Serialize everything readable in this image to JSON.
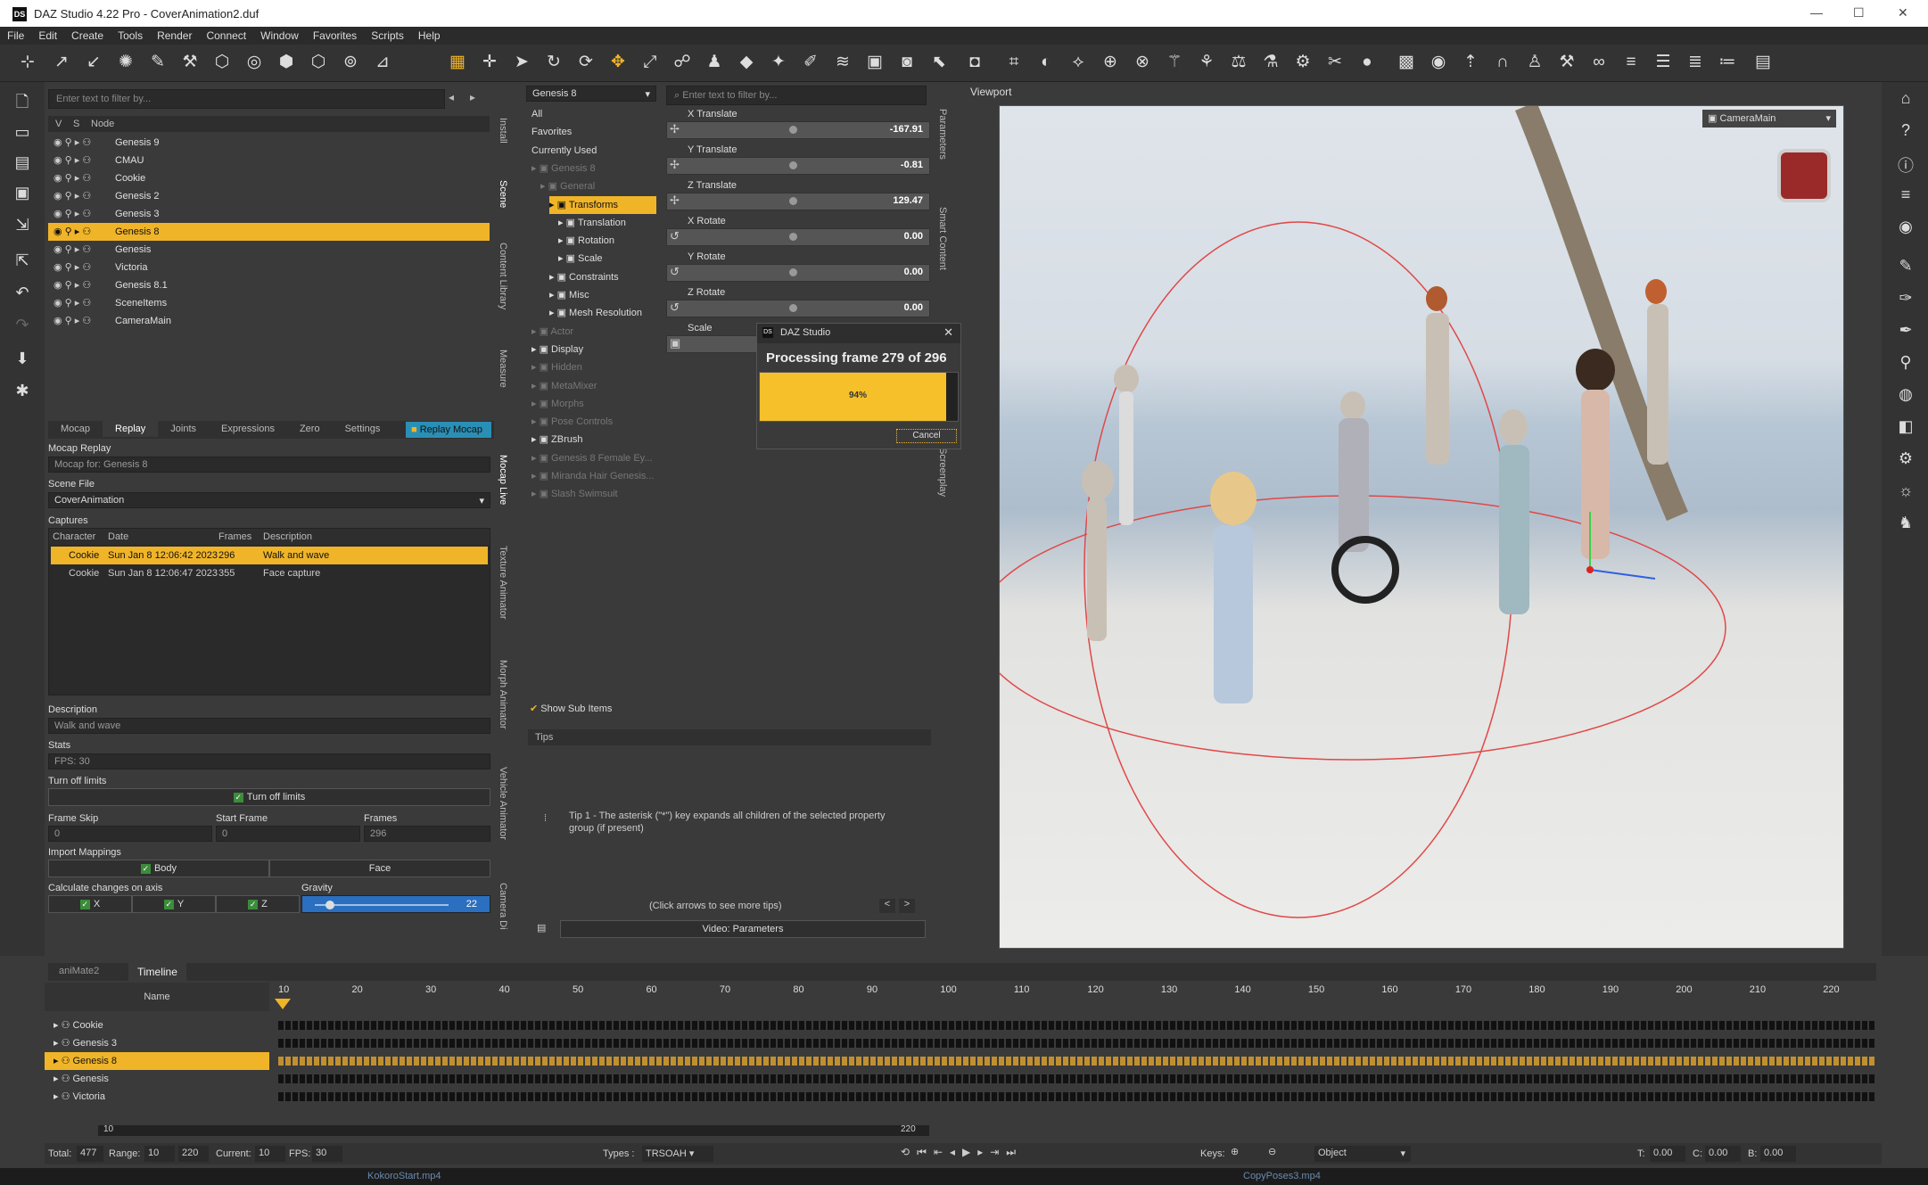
{
  "app": {
    "title": "DAZ Studio 4.22 Pro - CoverAnimation2.duf",
    "logo": "DS"
  },
  "menu": [
    "File",
    "Edit",
    "Create",
    "Tools",
    "Render",
    "Connect",
    "Window",
    "Favorites",
    "Scripts",
    "Help"
  ],
  "scene": {
    "filter_placeholder": "Enter text to filter by...",
    "col_v": "V",
    "col_s": "S",
    "col_node": "Node",
    "nodes": [
      "Genesis 9",
      "CMAU",
      "Cookie",
      "Genesis 2",
      "Genesis 3",
      "Genesis 8",
      "Genesis",
      "Victoria",
      "Genesis 8.1",
      "SceneItems",
      "CameraMain"
    ],
    "selected": "Genesis 8"
  },
  "side_tabs": {
    "install": "Install",
    "scene": "Scene",
    "content_library": "Content Library",
    "measure": "Measure",
    "mocap_live": "Mocap Live",
    "texture_animator": "Texture Animator",
    "morph_animator": "Morph Animator",
    "vehicle_animator": "Vehicle Animator",
    "camera_director": "Camera Di",
    "parameters": "Parameters",
    "smart_content": "Smart Content",
    "screenplay": "Screenplay"
  },
  "mocap": {
    "tabs": [
      "Mocap",
      "Replay",
      "Joints",
      "Expressions",
      "Zero",
      "Settings"
    ],
    "replay_button": "Replay Mocap",
    "section_title": "Mocap Replay",
    "mocap_for": "Mocap for: Genesis 8",
    "scene_file_label": "Scene File",
    "scene_file_value": "CoverAnimation",
    "captures_label": "Captures",
    "cap_headers": [
      "Character",
      "Date",
      "Frames",
      "Description"
    ],
    "captures": [
      {
        "character": "Cookie",
        "date": "Sun Jan 8 12:06:42 2023",
        "frames": "296",
        "description": "Walk and wave"
      },
      {
        "character": "Cookie",
        "date": "Sun Jan 8 12:06:47 2023",
        "frames": "355",
        "description": "Face capture"
      }
    ],
    "description_label": "Description",
    "description_value": "Walk and wave",
    "stats_label": "Stats",
    "stats_value": "FPS: 30",
    "turn_off_limits_label": "Turn off limits",
    "turn_off_limits_check": "Turn off limits",
    "frame_skip_label": "Frame Skip",
    "frame_skip_value": "0",
    "start_frame_label": "Start Frame",
    "start_frame_value": "0",
    "frames_label": "Frames",
    "frames_value": "296",
    "import_mappings_label": "Import Mappings",
    "body": "Body",
    "face": "Face",
    "calc_axis_label": "Calculate changes on axis",
    "axis_x": "X",
    "axis_y": "Y",
    "axis_z": "Z",
    "gravity_label": "Gravity",
    "gravity_value": "22"
  },
  "tree": {
    "selector": "Genesis 8",
    "items": [
      "All",
      "Favorites",
      "Currently Used",
      "Genesis 8",
      "General",
      "Transforms",
      "Translation",
      "Rotation",
      "Scale",
      "Constraints",
      "Misc",
      "Mesh Resolution",
      "Actor",
      "Display",
      "Hidden",
      "MetaMixer",
      "Morphs",
      "Pose Controls",
      "ZBrush",
      "Genesis 8 Female Ey...",
      "Miranda Hair Genesis...",
      "Slash Swimsuit"
    ],
    "show_sub": "Show Sub Items"
  },
  "params": {
    "filter_placeholder": "Enter text to filter by...",
    "rows": [
      {
        "name": "X Translate",
        "value": "-167.91"
      },
      {
        "name": "Y Translate",
        "value": "-0.81"
      },
      {
        "name": "Z Translate",
        "value": "129.47"
      },
      {
        "name": "X Rotate",
        "value": "0.00"
      },
      {
        "name": "Y Rotate",
        "value": "0.00"
      },
      {
        "name": "Z Rotate",
        "value": "0.00"
      },
      {
        "name": "Scale",
        "value": ""
      }
    ]
  },
  "tips": {
    "tab": "Tips",
    "text": "Tip 1 - The asterisk (\"*\") key expands all children of the selected property group (if present)",
    "nav": "(Click arrows to see more tips)",
    "video": "Video: Parameters"
  },
  "viewport": {
    "tab": "Viewport",
    "camera": "CameraMain"
  },
  "dialog": {
    "title": "DAZ Studio",
    "message": "Processing frame 279 of 296",
    "progress": 0.94,
    "progress_label": "94%",
    "cancel": "Cancel"
  },
  "timeline": {
    "tabs": [
      "aniMate2",
      "Timeline"
    ],
    "name_col": "Name",
    "ticks": [
      "10",
      "20",
      "30",
      "40",
      "50",
      "60",
      "70",
      "80",
      "90",
      "100",
      "110",
      "120",
      "130",
      "140",
      "150",
      "160",
      "170",
      "180",
      "190",
      "200",
      "210",
      "220"
    ],
    "rows": [
      "Cookie",
      "Genesis 3",
      "Genesis 8",
      "Genesis",
      "Victoria"
    ],
    "selected": "Genesis 8",
    "range_start": "10",
    "range_end": "220"
  },
  "status": {
    "total_label": "Total:",
    "total": "477",
    "range_label": "Range:",
    "range_start": "10",
    "range_end": "220",
    "current_label": "Current:",
    "current": "10",
    "fps_label": "FPS:",
    "fps": "30",
    "types_label": "Types :",
    "types": "TRSOAH",
    "keys_label": "Keys:",
    "object": "Object",
    "t_label": "T:",
    "t": "0.00",
    "c_label": "C:",
    "c": "0.00",
    "b_label": "B:",
    "b": "0.00"
  },
  "taskbar": {
    "left": "KokoroStart.mp4",
    "right": "CopyPoses3.mp4"
  },
  "colors": {
    "accent": "#f0b429",
    "panel": "#3a3a3a",
    "dark": "#2a2a2a"
  }
}
